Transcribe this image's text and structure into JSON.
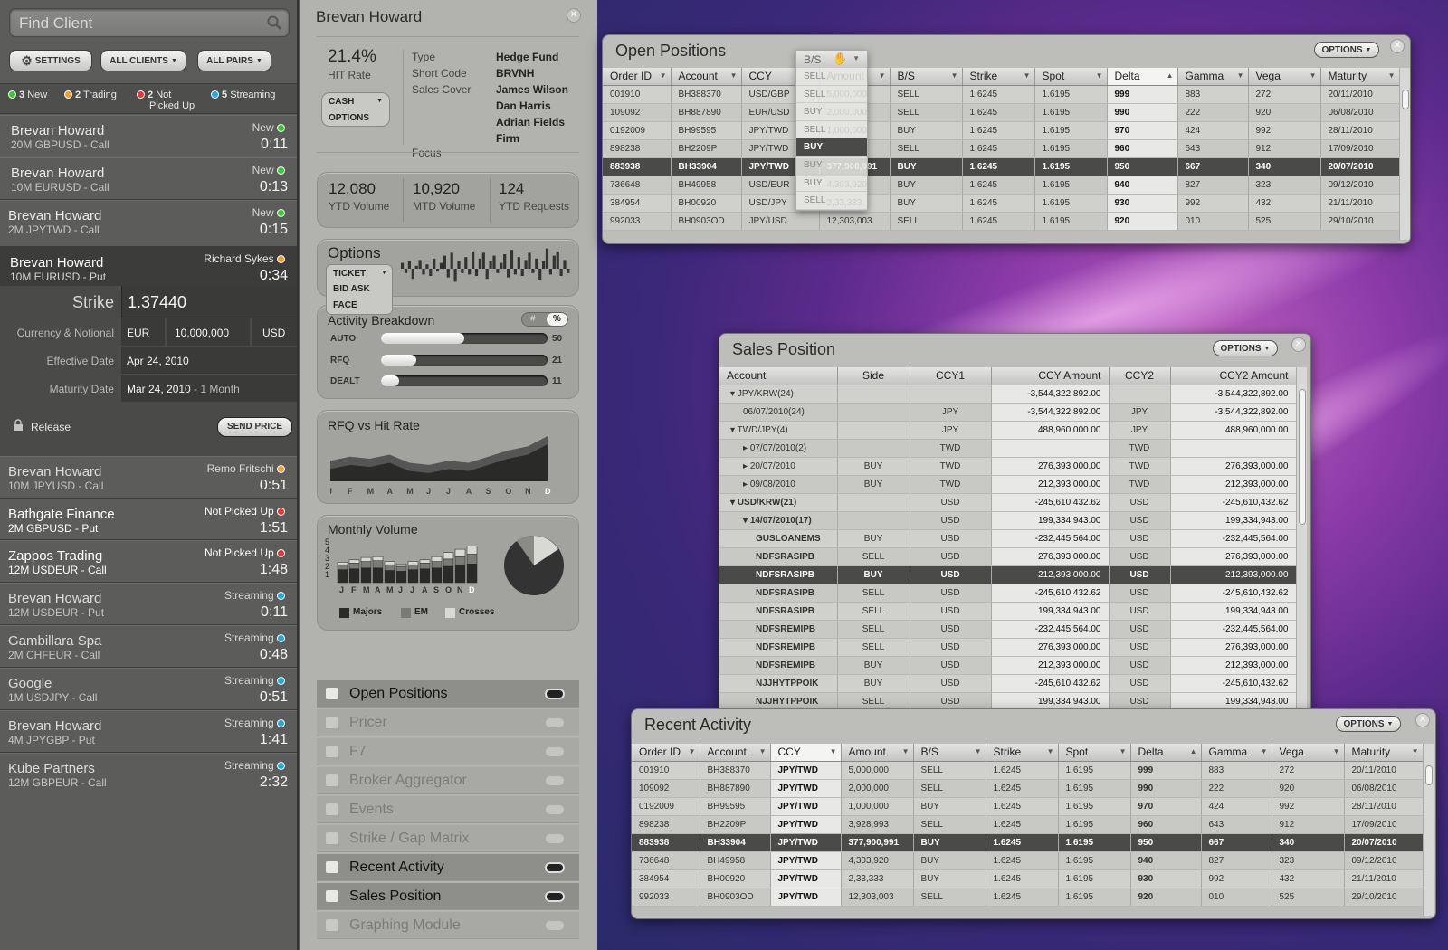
{
  "left": {
    "search_placeholder": "Find Client",
    "buttons": {
      "settings": "SETTINGS",
      "all_clients": "ALL CLIENTS",
      "all_pairs": "ALL PAIRS"
    },
    "status": {
      "new_count": "3",
      "new_label": "New",
      "trading_count": "2",
      "trading_label": "Trading",
      "notpicked_count": "2",
      "notpicked_label": "Not",
      "notpicked_label2": "Picked Up",
      "streaming_count": "5",
      "streaming_label": "Streaming"
    },
    "clients": [
      {
        "name": "Brevan Howard",
        "sub": "20M GBPUSD - Call",
        "status": "New",
        "time": "0:11"
      },
      {
        "name": "Brevan Howard",
        "sub": "10M EURUSD - Call",
        "status": "New",
        "time": "0:13"
      },
      {
        "name": "Brevan Howard",
        "sub": "2M JPYTWD - Call",
        "status": "New",
        "time": "0:15"
      },
      {
        "name": "Brevan Howard",
        "sub": "10M EURUSD - Put",
        "status": "Richard Sykes",
        "time": "0:34"
      },
      {
        "name": "Brevan Howard",
        "sub": "10M JPYUSD - Call",
        "status": "Remo Fritschi",
        "time": "0:51"
      },
      {
        "name": "Bathgate Finance",
        "sub": "2M GBPUSD - Put",
        "status": "Not Picked Up",
        "time": "1:51"
      },
      {
        "name": "Zappos Trading",
        "sub": "12M USDEUR - Call",
        "status": "Not Picked Up",
        "time": "1:48"
      },
      {
        "name": "Brevan Howard",
        "sub": "12M USDEUR - Put",
        "status": "Streaming",
        "time": "0:11"
      },
      {
        "name": "Gambillara Spa",
        "sub": "2M CHFEUR - Call",
        "status": "Streaming",
        "time": "0:48"
      },
      {
        "name": "Google",
        "sub": "1M USDJPY - Call",
        "status": "Streaming",
        "time": "0:51"
      },
      {
        "name": "Brevan Howard",
        "sub": "4M JPYGBP - Put",
        "status": "Streaming",
        "time": "1:41"
      },
      {
        "name": "Kube Partners",
        "sub": "12M GBPEUR - Call",
        "status": "Streaming",
        "time": "2:32"
      }
    ],
    "detail": {
      "strike_label": "Strike",
      "strike_value": "1.37440",
      "ccy_label": "Currency & Notional",
      "ccy1": "EUR",
      "notional": "10,000,000",
      "ccy2": "USD",
      "eff_label": "Effective Date",
      "eff_value": "Apr 24, 2010",
      "mat_label": "Maturity Date",
      "mat_value": "Mar 24, 2010",
      "mat_extra": " - 1 Month",
      "release": "Release",
      "send_price": "SEND PRICE"
    }
  },
  "mid": {
    "title": "Brevan Howard",
    "hit_rate": "21.4%",
    "hit_rate_label": "HIT Rate",
    "cash": "CASH",
    "options": "OPTIONS",
    "info_labels": [
      "Type",
      "Short Code",
      "Sales Cover",
      "",
      "",
      "Focus"
    ],
    "info_values": [
      "Hedge Fund",
      "BRVNH",
      "James Wilson",
      "Dan Harris",
      "Adrian Fields",
      "Firm"
    ],
    "stats": [
      {
        "v": "12,080",
        "l": "YTD Volume"
      },
      {
        "v": "10,920",
        "l": "MTD Volume"
      },
      {
        "v": "124",
        "l": "YTD Requests"
      }
    ],
    "options_title": "Options",
    "ticket_items": [
      "TICKET",
      "BID ASK",
      "FACE"
    ],
    "sparkline": [
      8,
      -6,
      10,
      -14,
      4,
      12,
      -8,
      6,
      -10,
      14,
      -4,
      8,
      18,
      -12,
      22,
      -18,
      10,
      -6,
      16,
      -8,
      24,
      -10,
      14,
      22,
      -14,
      10,
      18,
      -6,
      8,
      20,
      -12,
      26,
      -8,
      16,
      -10,
      12,
      22,
      -6,
      14,
      -16,
      10,
      28,
      -8,
      18,
      24,
      -10,
      12,
      -6
    ],
    "activity": {
      "title": "Activity Breakdown",
      "hash": "#",
      "pct": "%",
      "rows": [
        {
          "l": "AUTO",
          "v": 50
        },
        {
          "l": "RFQ",
          "v": 21
        },
        {
          "l": "DEALT",
          "v": 11
        }
      ],
      "max": 100
    },
    "rfq": {
      "title": "RFQ vs Hit Rate",
      "months": [
        "J",
        "F",
        "M",
        "A",
        "M",
        "J",
        "J",
        "A",
        "S",
        "O",
        "N",
        "D"
      ],
      "a": [
        20,
        24,
        22,
        26,
        18,
        16,
        20,
        18,
        24,
        30,
        34,
        44
      ],
      "b": [
        12,
        16,
        14,
        18,
        10,
        8,
        12,
        10,
        16,
        22,
        26,
        36
      ]
    },
    "monthly": {
      "title": "Monthly Volume",
      "ticks": [
        "5",
        "4",
        "3",
        "2",
        "1"
      ],
      "months": [
        "J",
        "F",
        "M",
        "A",
        "M",
        "J",
        "J",
        "A",
        "S",
        "O",
        "N",
        "D"
      ],
      "majors": [
        1.6,
        1.7,
        1.8,
        1.8,
        1.5,
        1.4,
        1.6,
        1.7,
        1.8,
        2.0,
        2.2,
        2.3
      ],
      "em": [
        0.6,
        0.7,
        0.8,
        0.9,
        0.7,
        0.6,
        0.6,
        0.7,
        0.8,
        0.9,
        1.0,
        1.2
      ],
      "crosses": [
        0.3,
        0.4,
        0.5,
        0.5,
        0.4,
        0.3,
        0.4,
        0.4,
        0.6,
        0.8,
        0.9,
        1.0
      ],
      "legend": [
        "Majors",
        "EM",
        "Crosses"
      ]
    },
    "nav": [
      {
        "l": "Open Positions",
        "on": true
      },
      {
        "l": "Pricer",
        "on": false
      },
      {
        "l": "F7",
        "on": false
      },
      {
        "l": "Broker Aggregator",
        "on": false
      },
      {
        "l": "Events",
        "on": false
      },
      {
        "l": "Strike / Gap Matrix",
        "on": false
      },
      {
        "l": "Recent Activity",
        "on": true
      },
      {
        "l": "Sales Position",
        "on": true
      },
      {
        "l": "Graphing Module",
        "on": false
      }
    ]
  },
  "open_positions": {
    "title": "Open Positions",
    "options": "OPTIONS",
    "headers": [
      "Order ID",
      "Account",
      "CCY",
      "Amount",
      "B/S",
      "Strike",
      "Spot",
      "Delta",
      "Gamma",
      "Vega",
      "Maturity"
    ],
    "rows": [
      [
        "001910",
        "BH388370",
        "USD/GBP",
        "5,000,000",
        "SELL",
        "1.6245",
        "1.6195",
        "999",
        "883",
        "272",
        "20/11/2010"
      ],
      [
        "109092",
        "BH887890",
        "EUR/USD",
        "2,000,000",
        "SELL",
        "1.6245",
        "1.6195",
        "990",
        "222",
        "920",
        "06/08/2010"
      ],
      [
        "0192009",
        "BH99595",
        "JPY/TWD",
        "1,000,000",
        "BUY",
        "1.6245",
        "1.6195",
        "970",
        "424",
        "992",
        "28/11/2010"
      ],
      [
        "898238",
        "BH2209P",
        "JPY/TWD",
        "3,928,993",
        "SELL",
        "1.6245",
        "1.6195",
        "960",
        "643",
        "912",
        "17/09/2010"
      ],
      [
        "883938",
        "BH33904",
        "JPY/TWD",
        "377,900,991",
        "BUY",
        "1.6245",
        "1.6195",
        "950",
        "667",
        "340",
        "20/07/2010"
      ],
      [
        "736648",
        "BH49958",
        "USD/EUR",
        "4,303,920",
        "BUY",
        "1.6245",
        "1.6195",
        "940",
        "827",
        "323",
        "09/12/2010"
      ],
      [
        "384954",
        "BH00920",
        "USD/JPY",
        "2,33,333",
        "BUY",
        "1.6245",
        "1.6195",
        "930",
        "992",
        "432",
        "21/11/2010"
      ],
      [
        "992033",
        "BH0903OD",
        "JPY/USD",
        "12,303,003",
        "SELL",
        "1.6245",
        "1.6195",
        "920",
        "010",
        "525",
        "29/10/2010"
      ]
    ],
    "popup_header": "B/S",
    "popup_items": [
      "SELL",
      "SELL",
      "BUY",
      "SELL",
      "BUY",
      "BUY",
      "BUY",
      "SELL"
    ]
  },
  "sales_position": {
    "title": "Sales Position",
    "options": "OPTIONS",
    "headers": [
      "Account",
      "Side",
      "CCY1",
      "CCY Amount",
      "CCY2",
      "CCY2 Amount"
    ],
    "rows": [
      {
        "a": "JPY/KRW(24)",
        "s": "",
        "c1": "",
        "amt": "-3,544,322,892.00",
        "c2": "",
        "amt2": "-3,544,322,892.00",
        "lvl": 0,
        "tw": "v"
      },
      {
        "a": "06/07/2010(24)",
        "s": "",
        "c1": "JPY",
        "amt": "-3,544,322,892.00",
        "c2": "JPY",
        "amt2": "-3,544,322,892.00",
        "lvl": 1,
        "tw": ""
      },
      {
        "a": "TWD/JPY(4)",
        "s": "",
        "c1": "JPY",
        "amt": "488,960,000.00",
        "c2": "JPY",
        "amt2": "488,960,000.00",
        "lvl": 0,
        "tw": "v"
      },
      {
        "a": "07/07/2010(2)",
        "s": "",
        "c1": "TWD",
        "amt": "",
        "c2": "TWD",
        "amt2": "",
        "lvl": 1,
        "tw": ">"
      },
      {
        "a": "20/07/2010",
        "s": "BUY",
        "c1": "TWD",
        "amt": "276,393,000.00",
        "c2": "TWD",
        "amt2": "276,393,000.00",
        "lvl": 1,
        "tw": ">"
      },
      {
        "a": "09/08/2010",
        "s": "BUY",
        "c1": "TWD",
        "amt": "212,393,000.00",
        "c2": "TWD",
        "amt2": "212,393,000.00",
        "lvl": 1,
        "tw": ">"
      },
      {
        "a": "USD/KRW(21)",
        "s": "",
        "c1": "USD",
        "amt": "-245,610,432.62",
        "c2": "USD",
        "amt2": "-245,610,432.62",
        "lvl": 0,
        "tw": "v",
        "b": true
      },
      {
        "a": "14/07/2010(17)",
        "s": "",
        "c1": "USD",
        "amt": "199,334,943.00",
        "c2": "USD",
        "amt2": "199,334,943.00",
        "lvl": 1,
        "tw": "v",
        "b": true
      },
      {
        "a": "GUSLOANEMS",
        "s": "BUY",
        "c1": "USD",
        "amt": "-232,445,564.00",
        "c2": "USD",
        "amt2": "-232,445,564.00",
        "lvl": 2,
        "tw": "",
        "b": true
      },
      {
        "a": "NDFSRASIPB",
        "s": "SELL",
        "c1": "USD",
        "amt": "276,393,000.00",
        "c2": "USD",
        "amt2": "276,393,000.00",
        "lvl": 2,
        "tw": "",
        "b": true
      },
      {
        "a": "NDFSRASIPB",
        "s": "BUY",
        "c1": "USD",
        "amt": "212,393,000.00",
        "c2": "USD",
        "amt2": "212,393,000.00",
        "lvl": 2,
        "tw": "",
        "b": true,
        "sel": true
      },
      {
        "a": "NDFSRASIPB",
        "s": "SELL",
        "c1": "USD",
        "amt": "-245,610,432.62",
        "c2": "USD",
        "amt2": "-245,610,432.62",
        "lvl": 2,
        "tw": "",
        "b": true
      },
      {
        "a": "NDFSRASIPB",
        "s": "SELL",
        "c1": "USD",
        "amt": "199,334,943.00",
        "c2": "USD",
        "amt2": "199,334,943.00",
        "lvl": 2,
        "tw": "",
        "b": true
      },
      {
        "a": "NDFSREMIPB",
        "s": "SELL",
        "c1": "USD",
        "amt": "-232,445,564.00",
        "c2": "USD",
        "amt2": "-232,445,564.00",
        "lvl": 2,
        "tw": "",
        "b": true
      },
      {
        "a": "NDFSREMIPB",
        "s": "SELL",
        "c1": "USD",
        "amt": "276,393,000.00",
        "c2": "USD",
        "amt2": "276,393,000.00",
        "lvl": 2,
        "tw": "",
        "b": true
      },
      {
        "a": "NDFSREMIPB",
        "s": "BUY",
        "c1": "USD",
        "amt": "212,393,000.00",
        "c2": "USD",
        "amt2": "212,393,000.00",
        "lvl": 2,
        "tw": "",
        "b": true
      },
      {
        "a": "NJJHYTPPOIK",
        "s": "BUY",
        "c1": "USD",
        "amt": "-245,610,432.62",
        "c2": "USD",
        "amt2": "-245,610,432.62",
        "lvl": 2,
        "tw": "",
        "b": true
      },
      {
        "a": "NJJHYTPPOIK",
        "s": "SELL",
        "c1": "USD",
        "amt": "199,334,943.00",
        "c2": "USD",
        "amt2": "199,334,943.00",
        "lvl": 2,
        "tw": "",
        "b": true
      }
    ]
  },
  "recent_activity": {
    "title": "Recent Activity",
    "options": "OPTIONS",
    "headers": [
      "Order ID",
      "Account",
      "CCY",
      "Amount",
      "B/S",
      "Strike",
      "Spot",
      "Delta",
      "Gamma",
      "Vega",
      "Maturity"
    ],
    "rows": [
      [
        "001910",
        "BH388370",
        "JPY/TWD",
        "5,000,000",
        "SELL",
        "1.6245",
        "1.6195",
        "999",
        "883",
        "272",
        "20/11/2010"
      ],
      [
        "109092",
        "BH887890",
        "JPY/TWD",
        "2,000,000",
        "SELL",
        "1.6245",
        "1.6195",
        "990",
        "222",
        "920",
        "06/08/2010"
      ],
      [
        "0192009",
        "BH99595",
        "JPY/TWD",
        "1,000,000",
        "BUY",
        "1.6245",
        "1.6195",
        "970",
        "424",
        "992",
        "28/11/2010"
      ],
      [
        "898238",
        "BH2209P",
        "JPY/TWD",
        "3,928,993",
        "SELL",
        "1.6245",
        "1.6195",
        "960",
        "643",
        "912",
        "17/09/2010"
      ],
      [
        "883938",
        "BH33904",
        "JPY/TWD",
        "377,900,991",
        "BUY",
        "1.6245",
        "1.6195",
        "950",
        "667",
        "340",
        "20/07/2010"
      ],
      [
        "736648",
        "BH49958",
        "JPY/TWD",
        "4,303,920",
        "BUY",
        "1.6245",
        "1.6195",
        "940",
        "827",
        "323",
        "09/12/2010"
      ],
      [
        "384954",
        "BH00920",
        "JPY/TWD",
        "2,33,333",
        "BUY",
        "1.6245",
        "1.6195",
        "930",
        "992",
        "432",
        "21/11/2010"
      ],
      [
        "992033",
        "BH0903OD",
        "JPY/TWD",
        "12,303,003",
        "SELL",
        "1.6245",
        "1.6195",
        "920",
        "010",
        "525",
        "29/10/2010"
      ]
    ]
  }
}
